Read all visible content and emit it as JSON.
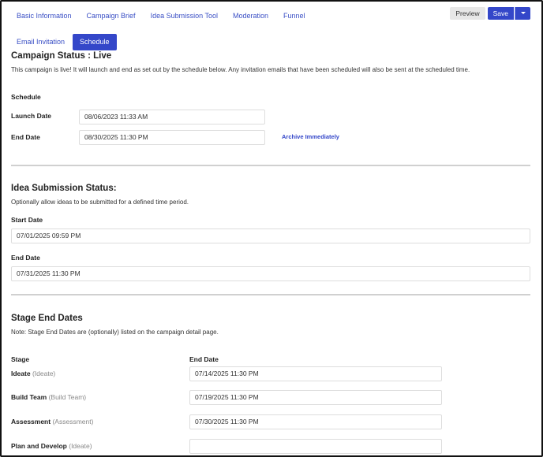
{
  "tabs": [
    {
      "label": "Basic Information"
    },
    {
      "label": "Campaign Brief"
    },
    {
      "label": "Idea Submission Tool"
    },
    {
      "label": "Moderation"
    },
    {
      "label": "Funnel"
    },
    {
      "label": "Email Invitation"
    },
    {
      "label": "Schedule",
      "active": true
    }
  ],
  "toolbar": {
    "preview_label": "Preview",
    "save_label": "Save"
  },
  "campaign_status": {
    "title": "Campaign Status : Live",
    "description": "This campaign is live! It will launch and end as set out by the schedule below. Any invitation emails that have been scheduled will also be sent at the scheduled time."
  },
  "schedule": {
    "heading": "Schedule",
    "launch_label": "Launch Date",
    "launch_value": "08/06/2023 11:33 AM",
    "end_label": "End Date",
    "end_value": "08/30/2025 11:30 PM",
    "archive_link": "Archive Immediately"
  },
  "idea_submission": {
    "title": "Idea Submission Status:",
    "description": "Optionally allow ideas to be submitted for a defined time period.",
    "start_label": "Start Date",
    "start_value": "07/01/2025 09:59 PM",
    "end_label": "End Date",
    "end_value": "07/31/2025 11:30 PM"
  },
  "stage_end_dates": {
    "title": "Stage End Dates",
    "note": "Note: Stage End Dates are (optionally) listed on the campaign detail page.",
    "col_stage": "Stage",
    "col_end_date": "End Date",
    "rows": [
      {
        "name": "Ideate",
        "type": "(Ideate)",
        "end_date": "07/14/2025 11:30 PM"
      },
      {
        "name": "Build Team",
        "type": "(Build Team)",
        "end_date": "07/19/2025 11:30 PM"
      },
      {
        "name": "Assessment",
        "type": "(Assessment)",
        "end_date": "07/30/2025 11:30 PM"
      },
      {
        "name": "Plan and Develop",
        "type": "(Ideate)",
        "end_date": ""
      }
    ]
  }
}
